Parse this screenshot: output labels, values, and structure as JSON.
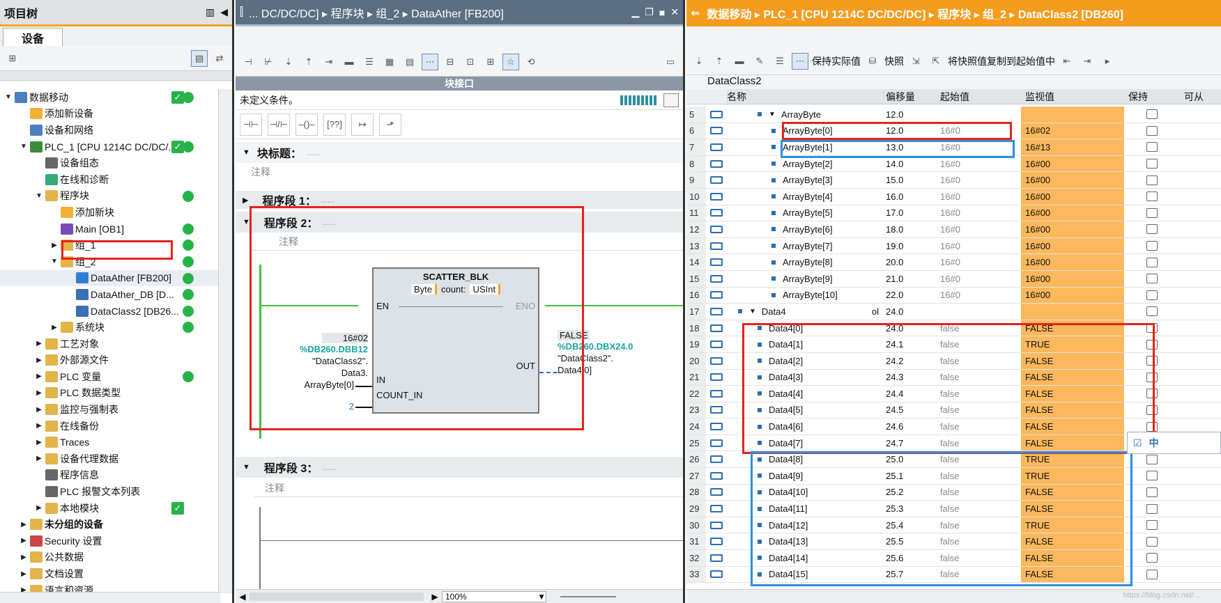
{
  "left": {
    "title": "项目树",
    "tab": "设备",
    "tree": [
      {
        "label": "数据移动",
        "indent": 0,
        "arrow": "▼",
        "icon": "doc",
        "status": "check-dot"
      },
      {
        "label": "添加新设备",
        "indent": 1,
        "arrow": "",
        "icon": "add"
      },
      {
        "label": "设备和网络",
        "indent": 1,
        "arrow": "",
        "icon": "net"
      },
      {
        "label": "PLC_1 [CPU 1214C DC/DC/...",
        "indent": 1,
        "arrow": "▼",
        "icon": "plc",
        "status": "check-dot"
      },
      {
        "label": "设备组态",
        "indent": 2,
        "arrow": "",
        "icon": "cfg"
      },
      {
        "label": "在线和诊断",
        "indent": 2,
        "arrow": "",
        "icon": "diag"
      },
      {
        "label": "程序块",
        "indent": 2,
        "arrow": "▼",
        "icon": "folder",
        "status": "dot"
      },
      {
        "label": "添加新块",
        "indent": 3,
        "arrow": "",
        "icon": "add"
      },
      {
        "label": "Main [OB1]",
        "indent": 3,
        "arrow": "",
        "icon": "ob",
        "status": "dot"
      },
      {
        "label": "组_1",
        "indent": 3,
        "arrow": "▶",
        "icon": "folder",
        "status": "dot"
      },
      {
        "label": "组_2",
        "indent": 3,
        "arrow": "▼",
        "icon": "folder",
        "status": "dot"
      },
      {
        "label": "DataAther [FB200]",
        "indent": 4,
        "arrow": "",
        "icon": "fb",
        "status": "dot",
        "selected": true
      },
      {
        "label": "DataAther_DB [D...",
        "indent": 4,
        "arrow": "",
        "icon": "db",
        "status": "dot"
      },
      {
        "label": "DataClass2 [DB26...",
        "indent": 4,
        "arrow": "",
        "icon": "db",
        "status": "dot"
      },
      {
        "label": "系统块",
        "indent": 3,
        "arrow": "▶",
        "icon": "folder",
        "status": "dot"
      },
      {
        "label": "工艺对象",
        "indent": 2,
        "arrow": "▶",
        "icon": "folder"
      },
      {
        "label": "外部源文件",
        "indent": 2,
        "arrow": "▶",
        "icon": "folder"
      },
      {
        "label": "PLC 变量",
        "indent": 2,
        "arrow": "▶",
        "icon": "folder",
        "status": "dot"
      },
      {
        "label": "PLC 数据类型",
        "indent": 2,
        "arrow": "▶",
        "icon": "folder"
      },
      {
        "label": "监控与强制表",
        "indent": 2,
        "arrow": "▶",
        "icon": "folder"
      },
      {
        "label": "在线备份",
        "indent": 2,
        "arrow": "▶",
        "icon": "folder"
      },
      {
        "label": "Traces",
        "indent": 2,
        "arrow": "▶",
        "icon": "folder"
      },
      {
        "label": "设备代理数据",
        "indent": 2,
        "arrow": "▶",
        "icon": "folder"
      },
      {
        "label": "程序信息",
        "indent": 2,
        "arrow": "",
        "icon": "info"
      },
      {
        "label": "PLC 报警文本列表",
        "indent": 2,
        "arrow": "",
        "icon": "list"
      },
      {
        "label": "本地模块",
        "indent": 2,
        "arrow": "▶",
        "icon": "folder",
        "status": "check"
      },
      {
        "label": "未分组的设备",
        "indent": 1,
        "arrow": "▶",
        "icon": "folder",
        "bold": true
      },
      {
        "label": "Security 设置",
        "indent": 1,
        "arrow": "▶",
        "icon": "sec"
      },
      {
        "label": "公共数据",
        "indent": 1,
        "arrow": "▶",
        "icon": "folder"
      },
      {
        "label": "文档设置",
        "indent": 1,
        "arrow": "▶",
        "icon": "folder"
      },
      {
        "label": "语言和资源",
        "indent": 1,
        "arrow": "▶",
        "icon": "folder"
      }
    ]
  },
  "mid": {
    "title": "... DC/DC/DC]  ▸  程序块  ▸  组_2  ▸  DataAther [FB200]",
    "block_interface": "块接口",
    "condition": "未定义条件。",
    "block_title": "块标题：",
    "block_title_dots": "......",
    "comment": "注释",
    "seg1": "程序段 1：",
    "seg2": "程序段 2：",
    "seg3": "程序段 3：",
    "seg_dots": "......",
    "fb": {
      "name": "SCATTER_BLK",
      "type": "Byte",
      "count_label": "count:",
      "count_type": "USInt",
      "en": "EN",
      "eno": "ENO",
      "in": "IN",
      "count_in": "COUNT_IN",
      "out": "OUT",
      "in_value": "16#02",
      "in_addr": "%DB260.DBB12",
      "in_sym1": "\"DataClass2\".",
      "in_sym2": "Data3.",
      "in_sym3": "ArrayByte[0]",
      "count_value": "2",
      "out_value": "FALSE",
      "out_addr": "%DB260.DBX24.0",
      "out_sym1": "\"DataClass2\".",
      "out_sym2": "Data4[0]"
    },
    "zoom": "100%"
  },
  "right": {
    "title": "数据移动  ▸  PLC_1 [CPU 1214C DC/DC/DC]  ▸  程序块  ▸  组_2  ▸  DataClass2 [DB260]",
    "keep_actual": "保持实际值",
    "snapshot": "快照",
    "copy_snapshot": "将快照值复制到起始值中",
    "db_name": "DataClass2",
    "headers": {
      "name": "名称",
      "offset": "偏移量",
      "start": "起始值",
      "monitor": "监视值",
      "retain": "保持",
      "access": "可从"
    },
    "rows": [
      {
        "n": "5",
        "name": "ArrayByte",
        "lvl": 1,
        "arrow": "▼",
        "off": "12.0",
        "start": "",
        "mon": ""
      },
      {
        "n": "6",
        "name": "ArrayByte[0]",
        "lvl": 2,
        "off": "12.0",
        "start": "16#0",
        "mon": "16#02"
      },
      {
        "n": "7",
        "name": "ArrayByte[1]",
        "lvl": 2,
        "off": "13.0",
        "start": "16#0",
        "mon": "16#13"
      },
      {
        "n": "8",
        "name": "ArrayByte[2]",
        "lvl": 2,
        "off": "14.0",
        "start": "16#0",
        "mon": "16#00"
      },
      {
        "n": "9",
        "name": "ArrayByte[3]",
        "lvl": 2,
        "off": "15.0",
        "start": "16#0",
        "mon": "16#00"
      },
      {
        "n": "10",
        "name": "ArrayByte[4]",
        "lvl": 2,
        "off": "16.0",
        "start": "16#0",
        "mon": "16#00"
      },
      {
        "n": "11",
        "name": "ArrayByte[5]",
        "lvl": 2,
        "off": "17.0",
        "start": "16#0",
        "mon": "16#00"
      },
      {
        "n": "12",
        "name": "ArrayByte[6]",
        "lvl": 2,
        "off": "18.0",
        "start": "16#0",
        "mon": "16#00"
      },
      {
        "n": "13",
        "name": "ArrayByte[7]",
        "lvl": 2,
        "off": "19.0",
        "start": "16#0",
        "mon": "16#00"
      },
      {
        "n": "14",
        "name": "ArrayByte[8]",
        "lvl": 2,
        "off": "20.0",
        "start": "16#0",
        "mon": "16#00"
      },
      {
        "n": "15",
        "name": "ArrayByte[9]",
        "lvl": 2,
        "off": "21.0",
        "start": "16#0",
        "mon": "16#00"
      },
      {
        "n": "16",
        "name": "ArrayByte[10]",
        "lvl": 2,
        "off": "22.0",
        "start": "16#0",
        "mon": "16#00"
      },
      {
        "n": "17",
        "name": "Data4",
        "lvl": 0,
        "arrow": "▼",
        "off": "24.0",
        "start": "",
        "mon": "",
        "suffix": "ol"
      },
      {
        "n": "18",
        "name": "Data4[0]",
        "lvl": 1,
        "off": "24.0",
        "start": "false",
        "mon": "FALSE"
      },
      {
        "n": "19",
        "name": "Data4[1]",
        "lvl": 1,
        "off": "24.1",
        "start": "false",
        "mon": "TRUE"
      },
      {
        "n": "20",
        "name": "Data4[2]",
        "lvl": 1,
        "off": "24.2",
        "start": "false",
        "mon": "FALSE"
      },
      {
        "n": "21",
        "name": "Data4[3]",
        "lvl": 1,
        "off": "24.3",
        "start": "false",
        "mon": "FALSE"
      },
      {
        "n": "22",
        "name": "Data4[4]",
        "lvl": 1,
        "off": "24.4",
        "start": "false",
        "mon": "FALSE"
      },
      {
        "n": "23",
        "name": "Data4[5]",
        "lvl": 1,
        "off": "24.5",
        "start": "false",
        "mon": "FALSE"
      },
      {
        "n": "24",
        "name": "Data4[6]",
        "lvl": 1,
        "off": "24.6",
        "start": "false",
        "mon": "FALSE"
      },
      {
        "n": "25",
        "name": "Data4[7]",
        "lvl": 1,
        "off": "24.7",
        "start": "false",
        "mon": "FALSE"
      },
      {
        "n": "26",
        "name": "Data4[8]",
        "lvl": 1,
        "off": "25.0",
        "start": "false",
        "mon": "TRUE"
      },
      {
        "n": "27",
        "name": "Data4[9]",
        "lvl": 1,
        "off": "25.1",
        "start": "false",
        "mon": "TRUE"
      },
      {
        "n": "28",
        "name": "Data4[10]",
        "lvl": 1,
        "off": "25.2",
        "start": "false",
        "mon": "FALSE"
      },
      {
        "n": "29",
        "name": "Data4[11]",
        "lvl": 1,
        "off": "25.3",
        "start": "false",
        "mon": "FALSE"
      },
      {
        "n": "30",
        "name": "Data4[12]",
        "lvl": 1,
        "off": "25.4",
        "start": "false",
        "mon": "TRUE"
      },
      {
        "n": "31",
        "name": "Data4[13]",
        "lvl": 1,
        "off": "25.5",
        "start": "false",
        "mon": "FALSE"
      },
      {
        "n": "32",
        "name": "Data4[14]",
        "lvl": 1,
        "off": "25.6",
        "start": "false",
        "mon": "FALSE"
      },
      {
        "n": "33",
        "name": "Data4[15]",
        "lvl": 1,
        "off": "25.7",
        "start": "false",
        "mon": "FALSE"
      }
    ],
    "float_badge": "中",
    "watermark": "https://blog.csdn.net/..."
  },
  "colors": {
    "accent": "#f59c1f",
    "green": "#27b34a",
    "highlight_red": "#e8221b",
    "highlight_blue": "#2b8fe3",
    "monitor": "#fbb85c"
  }
}
